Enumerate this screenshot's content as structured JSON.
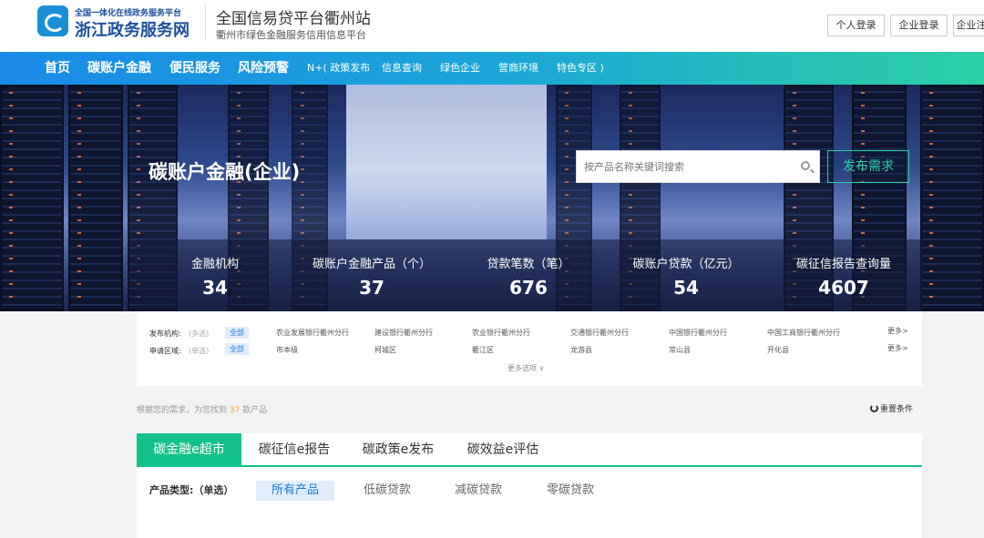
{
  "header": {
    "gov_sub": "全国一体化在线政务服务平台",
    "gov_main": "浙江政务服务网",
    "site_title": "全国信易贷平台衢州站",
    "site_sub": "衢州市绿色金融服务信用信息平台",
    "logins": [
      "个人登录",
      "企业登录",
      "企业注"
    ]
  },
  "nav": {
    "main": [
      "首页",
      "碳账户金融",
      "便民服务",
      "风险预警"
    ],
    "secondary": [
      "N+( 政策发布",
      "信息查询",
      "绿色企业",
      "营商环境",
      "特色专区 )"
    ]
  },
  "hero": {
    "title": "碳账户金融(企业)",
    "search_placeholder": "按产品名称关键词搜索",
    "publish_label": "发布需求"
  },
  "stats": [
    {
      "label": "金融机构",
      "value": "34"
    },
    {
      "label": "碳账户金融产品（个）",
      "value": "37"
    },
    {
      "label": "贷款笔数（笔）",
      "value": "676"
    },
    {
      "label": "碳账户贷款（亿元）",
      "value": "54"
    },
    {
      "label": "碳征信报告查询量",
      "value": "4607"
    }
  ],
  "filters": {
    "org": {
      "label": "发布机构:",
      "hint": "(多选)",
      "all": "全部",
      "options": [
        "农业发展银行衢州分行",
        "建设银行衢州分行",
        "农业银行衢州分行",
        "交通银行衢州分行",
        "中国银行衢州分行",
        "中国工商银行衢州分行"
      ],
      "more": "更多>"
    },
    "region": {
      "label": "申请区域:",
      "hint": "(单选)",
      "all": "全部",
      "options": [
        "市本级",
        "柯城区",
        "衢江区",
        "龙游县",
        "常山县",
        "开化县"
      ],
      "more": "更多>"
    },
    "more_options": "更多选项 ∨"
  },
  "results": {
    "prefix": "根据您的需求，为您找到",
    "count": "37",
    "suffix": "款产品",
    "reset_label": "重置条件"
  },
  "tabs": [
    "碳金融e超市",
    "碳征信e报告",
    "碳政策e发布",
    "碳效益e评估"
  ],
  "product_type": {
    "label": "产品类型:（单选）",
    "options": [
      "所有产品",
      "低碳贷款",
      "减碳贷款",
      "零碳贷款"
    ]
  }
}
